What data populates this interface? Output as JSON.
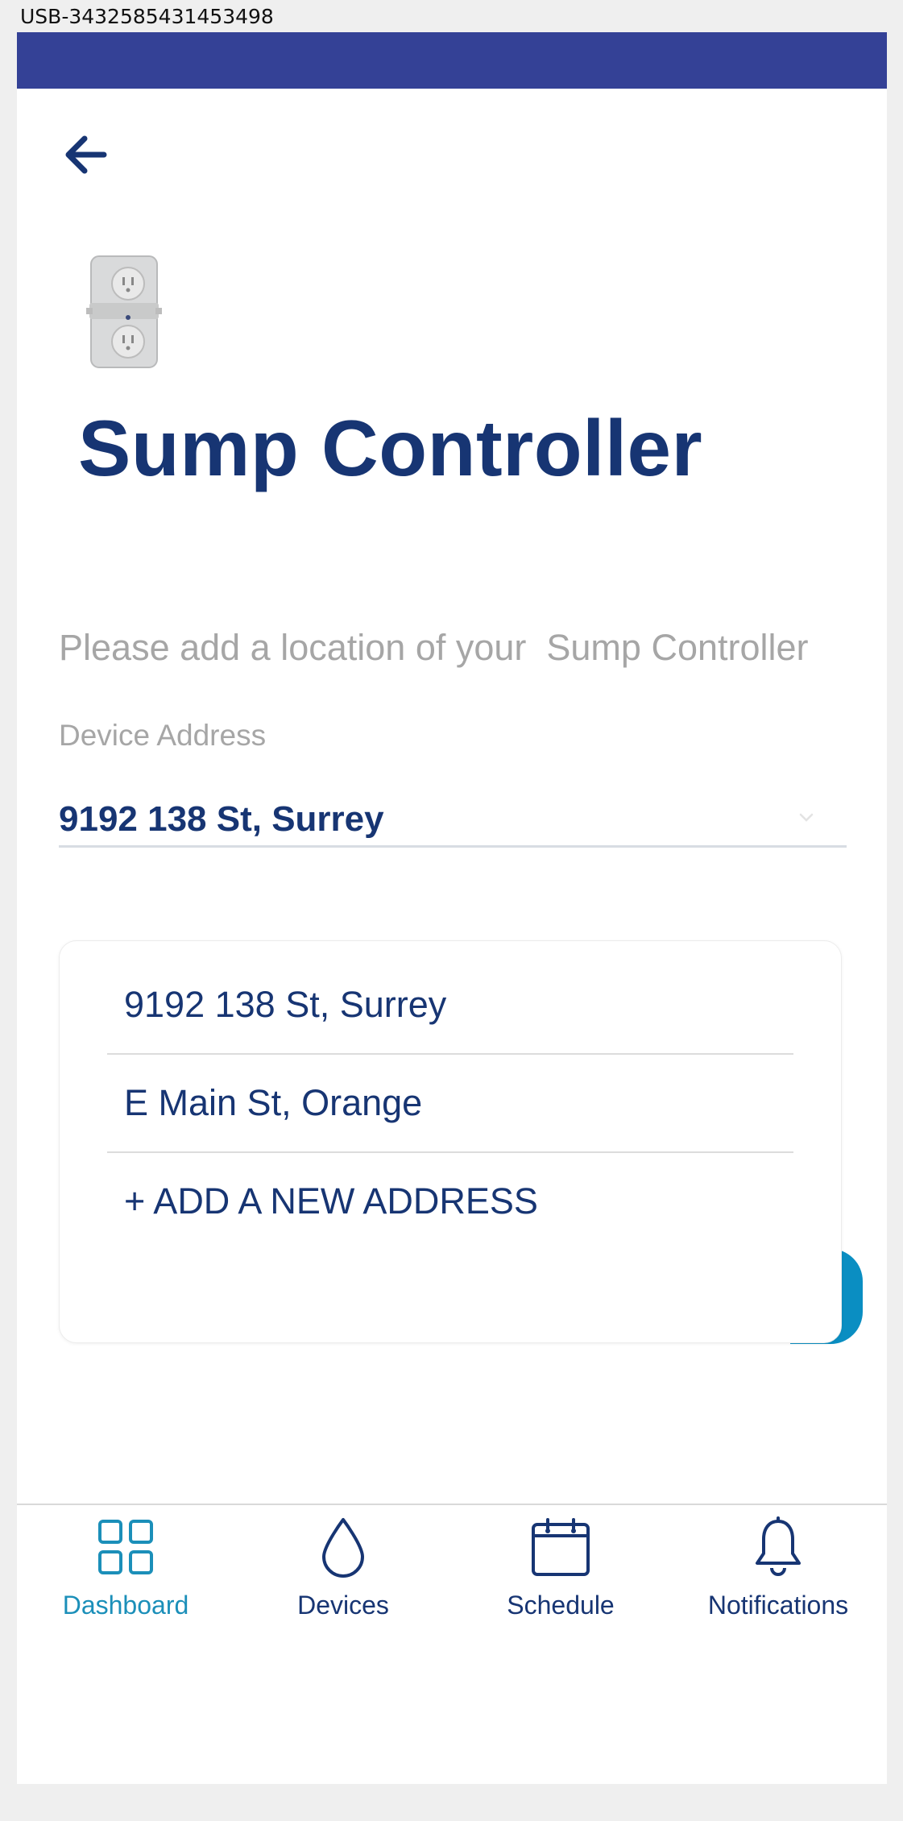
{
  "device_id": "USB-3432585431453498",
  "colors": {
    "status_bar": "#344196",
    "primary": "#173573",
    "accent": "#1b8fb9",
    "muted": "#a6a6a6"
  },
  "header": {
    "back_icon": "arrow-left-icon",
    "device_image": "smart-outlet-image",
    "title": "Sump Controller"
  },
  "form": {
    "prompt": "Please add a location of your  Sump Controller",
    "address_label": "Device Address",
    "address_value": "9192 138 St, Surrey",
    "dropdown_icon": "chevron-down-icon"
  },
  "dropdown": {
    "options": [
      "9192 138 St, Surrey",
      "E Main St, Orange",
      "+ ADD A NEW ADDRESS"
    ]
  },
  "bottom_nav": {
    "items": [
      {
        "label": "Dashboard",
        "icon": "dashboard-grid-icon",
        "active": true
      },
      {
        "label": "Devices",
        "icon": "water-drop-icon",
        "active": false
      },
      {
        "label": "Schedule",
        "icon": "calendar-icon",
        "active": false
      },
      {
        "label": "Notifications",
        "icon": "bell-icon",
        "active": false
      }
    ]
  }
}
